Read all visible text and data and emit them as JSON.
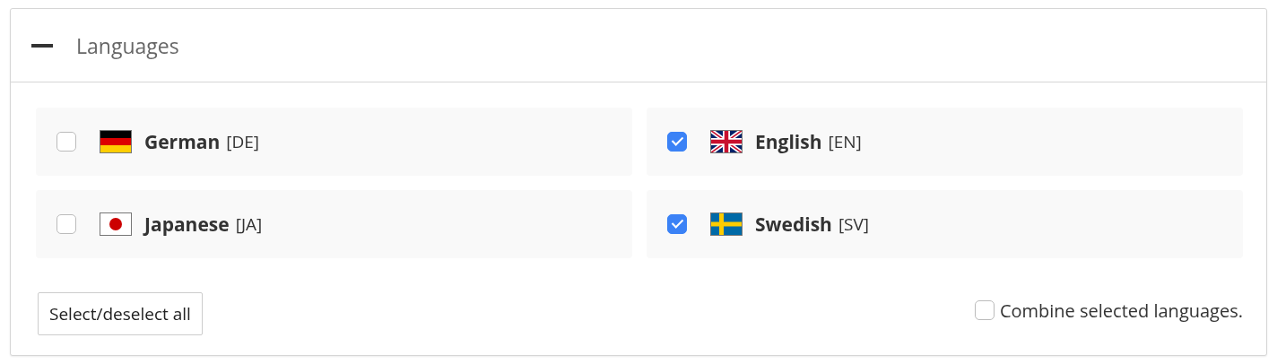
{
  "panel": {
    "title": "Languages",
    "expanded": true
  },
  "languages": [
    {
      "name": "German",
      "code": "[DE]",
      "kind": "de",
      "checked": false
    },
    {
      "name": "English",
      "code": "[EN]",
      "kind": "gb",
      "checked": true
    },
    {
      "name": "Japanese",
      "code": "[JA]",
      "kind": "jp",
      "checked": false
    },
    {
      "name": "Swedish",
      "code": "[SV]",
      "kind": "se",
      "checked": true
    }
  ],
  "select_all_button": "Select/deselect all",
  "combine": {
    "label": "Combine selected languages.",
    "checked": false
  }
}
